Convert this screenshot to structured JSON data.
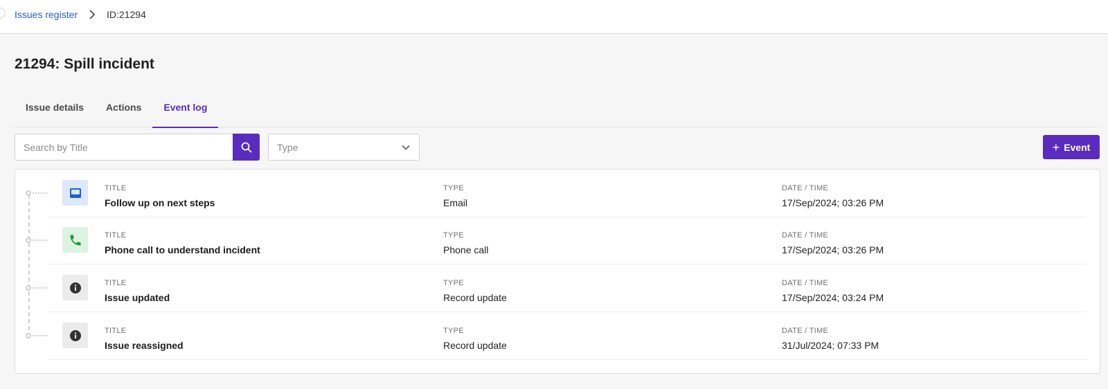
{
  "breadcrumb": {
    "root_label": "Issues register",
    "current_label": "ID:21294"
  },
  "page": {
    "title": "21294: Spill incident"
  },
  "tabs": [
    {
      "label": "Issue details",
      "active": false
    },
    {
      "label": "Actions",
      "active": false
    },
    {
      "label": "Event log",
      "active": true
    }
  ],
  "toolbar": {
    "search_placeholder": "Search by Title",
    "search_value": "",
    "type_placeholder": "Type",
    "add_event_label": "Event"
  },
  "columns": {
    "title": "Title",
    "type": "Type",
    "datetime": "Date / Time"
  },
  "events": [
    {
      "icon": "inbox-icon",
      "title": "Follow up on next steps",
      "type": "Email",
      "datetime": "17/Sep/2024; 03:26 PM"
    },
    {
      "icon": "phone-icon",
      "title": "Phone call to understand incident",
      "type": "Phone call",
      "datetime": "17/Sep/2024; 03:26 PM"
    },
    {
      "icon": "info-icon",
      "title": "Issue updated",
      "type": "Record update",
      "datetime": "17/Sep/2024; 03:24 PM"
    },
    {
      "icon": "info-icon",
      "title": "Issue reassigned",
      "type": "Record update",
      "datetime": "31/Jul/2024; 07:33 PM"
    }
  ],
  "colors": {
    "accent": "#5b2bbf",
    "link": "#1f5fce",
    "email_icon": "#1f5fce",
    "phone_icon": "#1a9a3c",
    "info_icon": "#333333"
  }
}
